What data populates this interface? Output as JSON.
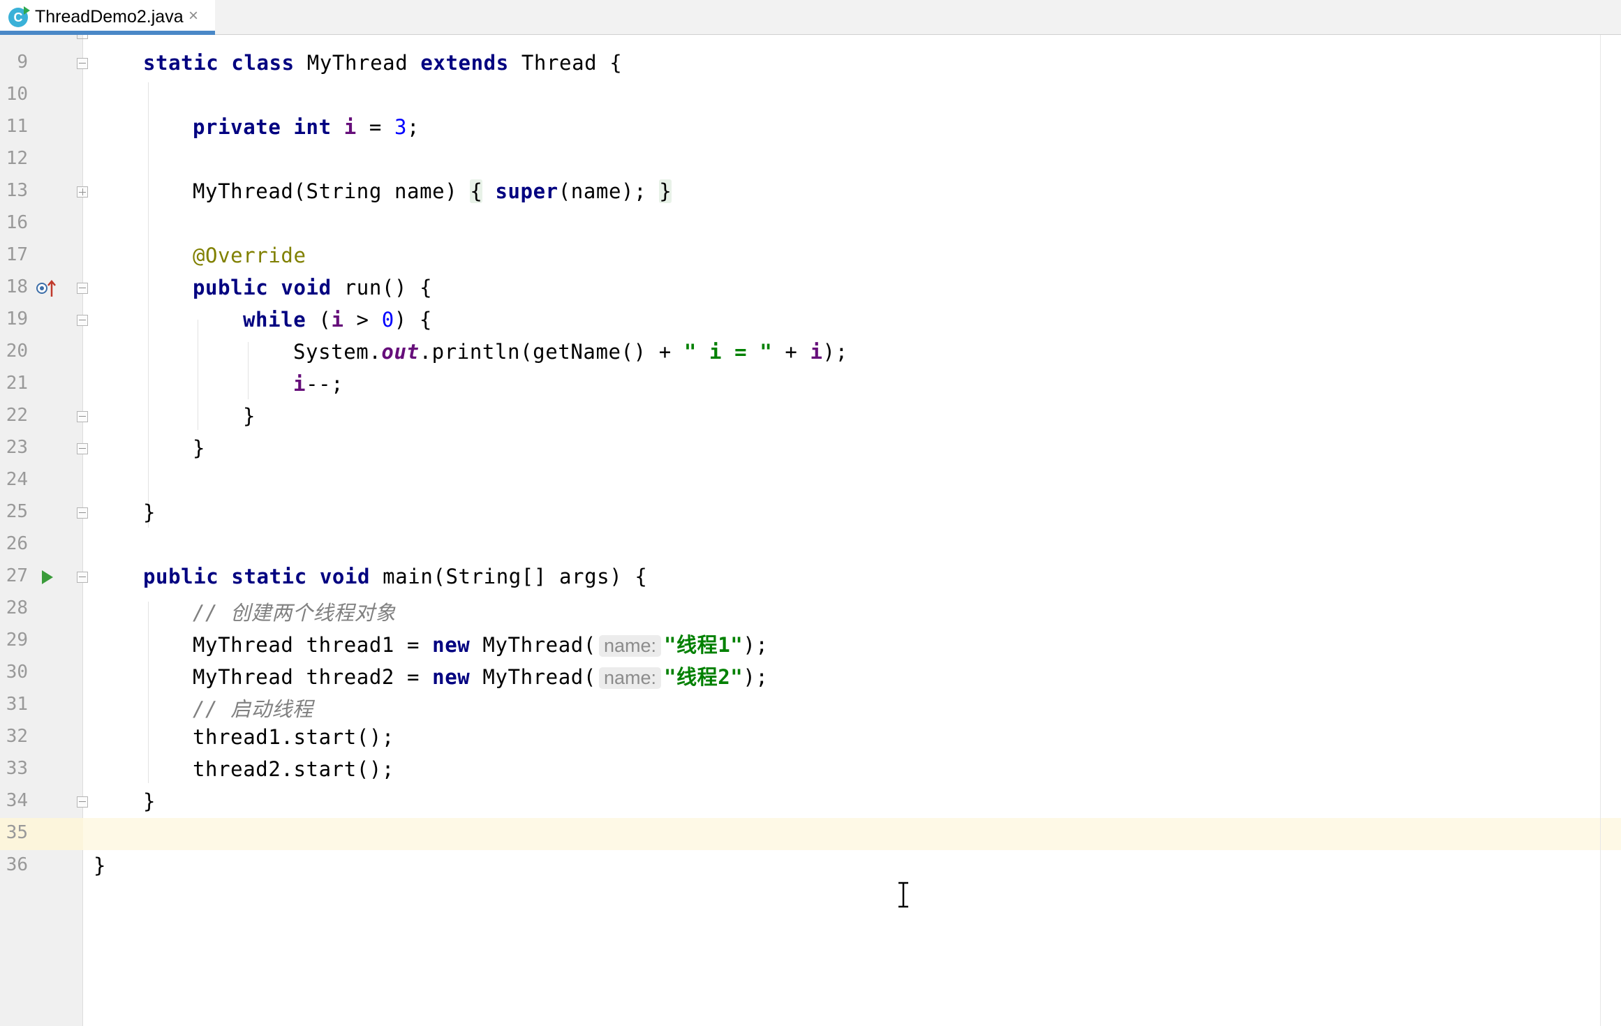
{
  "tab": {
    "title": "ThreadDemo2.java",
    "icon_letter": "C",
    "close_glyph": "×"
  },
  "colors": {
    "keyword": "#000080",
    "field": "#660e7a",
    "number": "#0000ff",
    "string": "#008000",
    "annotation": "#808000",
    "comment": "#808080",
    "current_line": "#fef9e6",
    "tab_underline": "#4a88c7"
  },
  "editor": {
    "lines": [
      {
        "n": "9"
      },
      {
        "n": "10"
      },
      {
        "n": "11"
      },
      {
        "n": "12"
      },
      {
        "n": "13"
      },
      {
        "n": "16"
      },
      {
        "n": "17"
      },
      {
        "n": "18"
      },
      {
        "n": "19"
      },
      {
        "n": "20"
      },
      {
        "n": "21"
      },
      {
        "n": "22"
      },
      {
        "n": "23"
      },
      {
        "n": "24"
      },
      {
        "n": "25"
      },
      {
        "n": "26"
      },
      {
        "n": "27"
      },
      {
        "n": "28"
      },
      {
        "n": "29"
      },
      {
        "n": "30"
      },
      {
        "n": "31"
      },
      {
        "n": "32"
      },
      {
        "n": "33"
      },
      {
        "n": "34"
      },
      {
        "n": "35"
      },
      {
        "n": "36"
      }
    ],
    "tokens": {
      "l9": {
        "static": "static",
        "class": "class",
        "name": " MyThread ",
        "extends": "extends",
        "rest": " Thread {"
      },
      "l11": {
        "private": "private",
        "int": "int",
        "i": "i",
        "eq": " = ",
        "num": "3",
        "semi": ";"
      },
      "l13": {
        "ctor": "MyThread(String name)",
        "open": "{",
        "super": "super",
        "args": "(name);",
        "close": "}"
      },
      "l17": {
        "ann": "@Override"
      },
      "l18": {
        "public": "public",
        "void": "void",
        "rest": " run() {"
      },
      "l19": {
        "while": "while",
        "p1": " (",
        "i": "i",
        "gt": " > ",
        "num": "0",
        "p2": ") {"
      },
      "l20": {
        "sys": "System.",
        "out": "out",
        "call": ".println(getName() + ",
        "str": "\" i = \"",
        "plus": " + ",
        "i": "i",
        "end": ");"
      },
      "l21": {
        "i": "i",
        "rest": "--;"
      },
      "l22": {
        "brace": "}"
      },
      "l23": {
        "brace": "}"
      },
      "l25": {
        "brace": "}"
      },
      "l27": {
        "public": "public",
        "static": "static",
        "void": "void",
        "rest": " main(String[] args) {"
      },
      "l28": {
        "cmt": "// 创建两个线程对象"
      },
      "l29": {
        "decl": "MyThread thread1 = ",
        "new": "new",
        "call": " MyThread(",
        "hint": "name:",
        "str": "\"线程1\"",
        "end": ");"
      },
      "l30": {
        "decl": "MyThread thread2 = ",
        "new": "new",
        "call": " MyThread(",
        "hint": "name:",
        "str": "\"线程2\"",
        "end": ");"
      },
      "l31": {
        "cmt": "// 启动线程"
      },
      "l32": {
        "code": "thread1.start();"
      },
      "l33": {
        "code": "thread2.start();"
      },
      "l34": {
        "brace": "}"
      },
      "l36": {
        "brace": "}"
      }
    }
  }
}
